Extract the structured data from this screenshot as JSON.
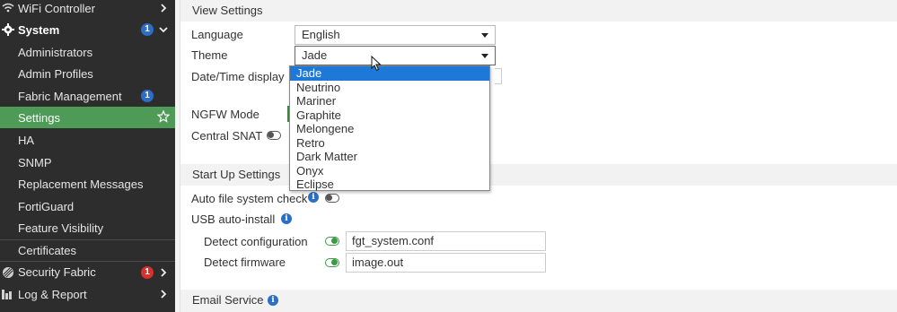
{
  "sidebar": {
    "items": [
      {
        "label": "WiFi Controller",
        "icon": "wifi-icon",
        "arrow": "right"
      },
      {
        "label": "System",
        "icon": "gear-icon",
        "badge": "1",
        "arrow": "down"
      },
      {
        "label": "Administrators"
      },
      {
        "label": "Admin Profiles"
      },
      {
        "label": "Fabric Management",
        "badge": "1"
      },
      {
        "label": "Settings",
        "active": true,
        "icon": "star-icon"
      },
      {
        "label": "HA"
      },
      {
        "label": "SNMP"
      },
      {
        "label": "Replacement Messages"
      },
      {
        "label": "FortiGuard"
      },
      {
        "label": "Feature Visibility"
      },
      {
        "label": "Certificates"
      },
      {
        "label": "Security Fabric",
        "icon": "security-fabric-icon",
        "badge": "1",
        "badge_color": "#d9302c",
        "arrow": "right"
      },
      {
        "label": "Log & Report",
        "icon": "chart-icon",
        "arrow": "right"
      }
    ]
  },
  "view_settings": {
    "title": "View Settings",
    "language_label": "Language",
    "language_value": "English",
    "theme_label": "Theme",
    "theme_value": "Jade",
    "datetime_label": "Date/Time display",
    "ngfw_label": "NGFW Mode",
    "central_snat_label": "Central SNAT",
    "theme_options": [
      "Jade",
      "Neutrino",
      "Mariner",
      "Graphite",
      "Melongene",
      "Retro",
      "Dark Matter",
      "Onyx",
      "Eclipse"
    ]
  },
  "startup_settings": {
    "title": "Start Up Settings",
    "auto_fs_check_label": "Auto file system check",
    "usb_auto_install_label": "USB auto-install",
    "detect_config_label": "Detect configuration",
    "detect_config_value": "fgt_system.conf",
    "detect_firmware_label": "Detect firmware",
    "detect_firmware_value": "image.out"
  },
  "email_service": {
    "title": "Email Service"
  },
  "colors": {
    "sidebar_bg": "#2d2d2d",
    "active_green": "#4d9b56",
    "badge_blue": "#2c6ec6",
    "badge_red": "#d9302c",
    "selection_blue": "#1e78d7"
  }
}
